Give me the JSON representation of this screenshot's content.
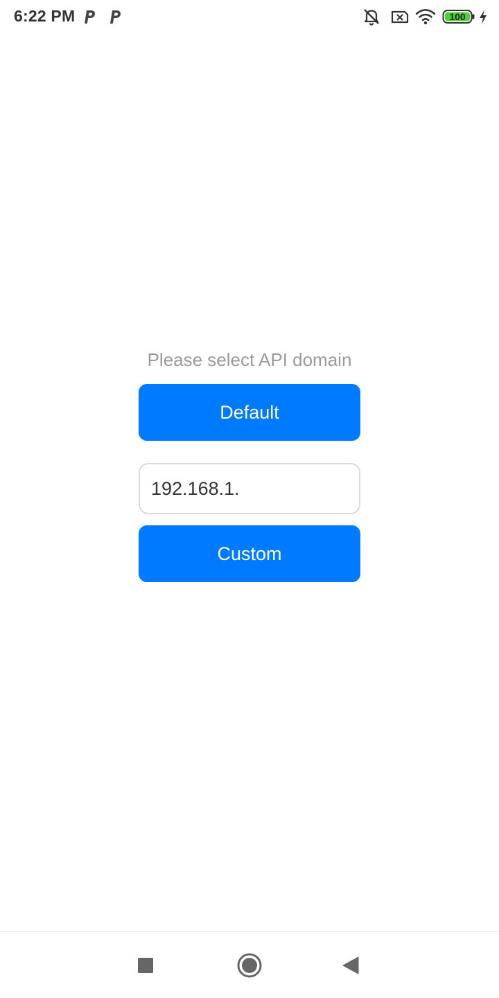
{
  "status_bar": {
    "time": "6:22 PM",
    "notification_icons": [
      "p-notification-icon",
      "p-notification-icon"
    ],
    "system_icons": [
      "mute-icon",
      "no-sim-icon",
      "wifi-icon",
      "battery-icon",
      "charging-icon"
    ],
    "battery_level": "100",
    "battery_color": "#4cd137"
  },
  "main": {
    "prompt": "Please select API domain",
    "default_button_label": "Default",
    "domain_input_value": "192.168.1.",
    "custom_button_label": "Custom",
    "accent_color": "#007aff"
  },
  "nav_bar": {
    "icons": [
      "recents-icon",
      "home-icon",
      "back-icon"
    ]
  }
}
